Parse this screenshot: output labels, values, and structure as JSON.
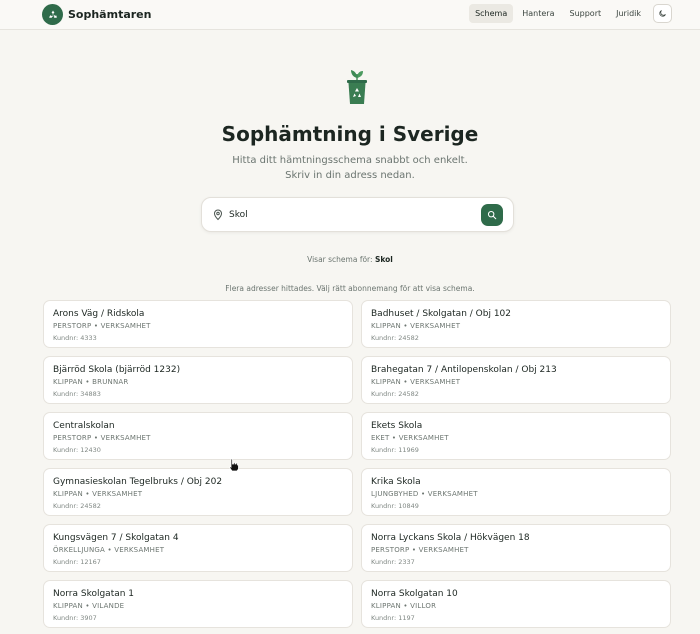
{
  "brand": {
    "name": "Sophämtaren"
  },
  "nav": {
    "items": [
      "Schema",
      "Hantera",
      "Support",
      "Juridik"
    ],
    "active": "Schema"
  },
  "hero": {
    "title": "Sophämtning i Sverige",
    "subtitle_line1": "Hitta ditt hämtningsschema snabbt och enkelt.",
    "subtitle_line2": "Skriv in din adress nedan."
  },
  "search": {
    "value": "Skol"
  },
  "showing": {
    "prefix": "Visar schema för:",
    "query": "Skol"
  },
  "results_note": "Flera adresser hittades. Välj rätt abonnemang för att visa schema.",
  "results": [
    {
      "title": "Arons Väg / Ridskola",
      "meta": "PERSTORP • VERKSAMHET",
      "customer": "Kundnr: 4333"
    },
    {
      "title": "Badhuset / Skolgatan / Obj 102",
      "meta": "KLIPPAN • VERKSAMHET",
      "customer": "Kundnr: 24582"
    },
    {
      "title": "Bjärröd Skola (bjärröd 1232)",
      "meta": "KLIPPAN • BRUNNAR",
      "customer": "Kundnr: 34883"
    },
    {
      "title": "Brahegatan 7 / Antilopenskolan / Obj 213",
      "meta": "KLIPPAN • VERKSAMHET",
      "customer": "Kundnr: 24582"
    },
    {
      "title": "Centralskolan",
      "meta": "PERSTORP • VERKSAMHET",
      "customer": "Kundnr: 12430"
    },
    {
      "title": "Ekets Skola",
      "meta": "EKET • VERKSAMHET",
      "customer": "Kundnr: 11969"
    },
    {
      "title": "Gymnasieskolan Tegelbruks / Obj 202",
      "meta": "KLIPPAN • VERKSAMHET",
      "customer": "Kundnr: 24582"
    },
    {
      "title": "Krika Skola",
      "meta": "LJUNGBYHED • VERKSAMHET",
      "customer": "Kundnr: 10849"
    },
    {
      "title": "Kungsvägen 7 / Skolgatan 4",
      "meta": "ÖRKELLJUNGA • VERKSAMHET",
      "customer": "Kundnr: 12167"
    },
    {
      "title": "Norra Lyckans Skola / Hökvägen 18",
      "meta": "PERSTORP • VERKSAMHET",
      "customer": "Kundnr: 2337"
    },
    {
      "title": "Norra Skolgatan 1",
      "meta": "KLIPPAN • VILANDE",
      "customer": "Kundnr: 3907"
    },
    {
      "title": "Norra Skolgatan 10",
      "meta": "KLIPPAN • VILLOR",
      "customer": "Kundnr: 1197"
    }
  ],
  "colors": {
    "accent": "#2f6b4a",
    "background": "#f7f6f2"
  }
}
